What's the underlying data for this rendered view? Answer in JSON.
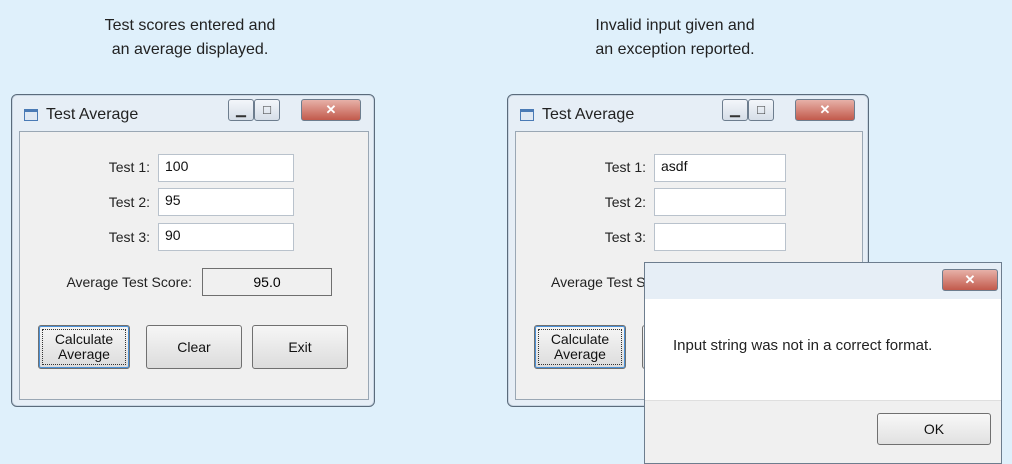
{
  "left": {
    "caption_line1": "Test scores entered and",
    "caption_line2": "an average displayed.",
    "window": {
      "title": "Test Average",
      "test1_label": "Test 1:",
      "test1_value": "100",
      "test2_label": "Test 2:",
      "test2_value": "95",
      "test3_label": "Test 3:",
      "test3_value": "90",
      "average_label": "Average Test Score:",
      "average_value": "95.0",
      "calculate_label": "Calculate\nAverage",
      "clear_label": "Clear",
      "exit_label": "Exit"
    }
  },
  "right": {
    "caption_line1": "Invalid input given and",
    "caption_line2": "an exception reported.",
    "window": {
      "title": "Test Average",
      "test1_label": "Test 1:",
      "test1_value": "asdf",
      "test2_label": "Test 2:",
      "test2_value": "",
      "test3_label": "Test 3:",
      "test3_value": "",
      "average_label_partial": "Average Test S",
      "calculate_label": "Calculate\nAverage"
    },
    "message_box": {
      "message": "Input string was not in a correct format.",
      "ok_label": "OK"
    }
  },
  "icons": {
    "minimize": "minimize-icon",
    "maximize": "maximize-icon",
    "close": "close-icon",
    "app": "app-icon"
  }
}
